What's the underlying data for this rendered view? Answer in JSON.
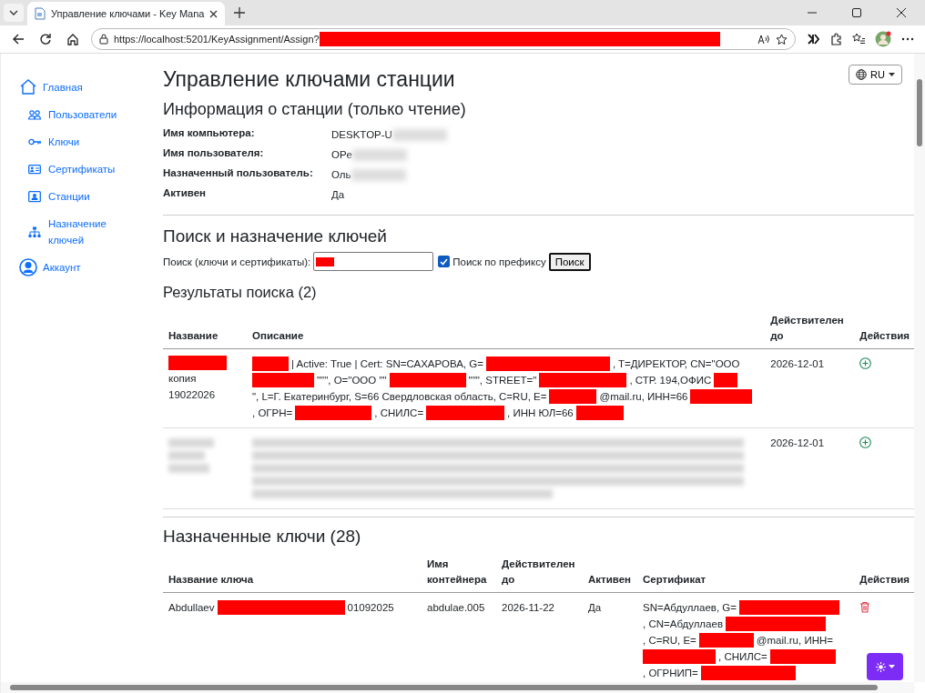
{
  "browser": {
    "tab_title": "Управление ключами - Key Mana",
    "url": "https://localhost:5201/KeyAssignment/Assign?",
    "url_redacted": true
  },
  "sidebar": {
    "items": [
      {
        "label": "Главная",
        "top": true
      },
      {
        "label": "Пользователи",
        "top": false
      },
      {
        "label": "Ключи",
        "top": false
      },
      {
        "label": "Сертификаты",
        "top": false
      },
      {
        "label": "Станции",
        "top": false
      },
      {
        "label": "Назначение ключей",
        "top": false
      },
      {
        "label": "Аккаунт",
        "top": true
      }
    ]
  },
  "language": {
    "label": "RU"
  },
  "title": "Управление ключами станции",
  "station_info": {
    "heading": "Информация о станции (только чтение)",
    "rows": [
      {
        "label": "Имя компьютера:",
        "value": "DESKTOP-U",
        "blurred": true
      },
      {
        "label": "Имя пользователя:",
        "value": "OPe",
        "blurred": true
      },
      {
        "label": "Назначенный пользователь:",
        "value": "Оль",
        "blurred": true
      },
      {
        "label": "Активен",
        "value": "Да",
        "blurred": false
      }
    ]
  },
  "search": {
    "heading": "Поиск и назначение ключей",
    "label": "Поиск (ключи и сертификаты):",
    "value_redacted": true,
    "prefix_label": "Поиск по префиксу",
    "prefix_checked": true,
    "button": "Поиск"
  },
  "results": {
    "heading": "Результаты поиска (2)",
    "columns": [
      "Название",
      "Описание",
      "Действителен до",
      "Действия"
    ],
    "rows": [
      {
        "kind": "visible",
        "name": [
          {
            "kind": "redacted"
          },
          {
            "kind": "text",
            "text": "копия 19022026"
          }
        ],
        "description": [
          {
            "kind": "redacted"
          },
          {
            "kind": "text",
            "text": "| Active: True | Cert: SN=САХАРОВА, G="
          },
          {
            "kind": "redacted"
          },
          {
            "kind": "text",
            "text": ", T=ДИРЕКТОР, CN=\"ООО"
          },
          {
            "kind": "redacted"
          },
          {
            "kind": "text",
            "text": "\"\"\", O=\"ООО \"\""
          },
          {
            "kind": "redacted"
          },
          {
            "kind": "text",
            "text": "\"\"\", STREET=\""
          },
          {
            "kind": "redacted"
          },
          {
            "kind": "text",
            "text": ", СТР. 194,ОФИС"
          },
          {
            "kind": "redacted"
          },
          {
            "kind": "text",
            "text": "\", L=Г. Екатеринбург, S=66 Свердловская область, C=RU, E="
          },
          {
            "kind": "redacted"
          },
          {
            "kind": "text",
            "text": "@mail.ru, ИНН=66"
          },
          {
            "kind": "redacted"
          },
          {
            "kind": "text",
            "text": ", ОГРН="
          },
          {
            "kind": "redacted"
          },
          {
            "kind": "text",
            "text": ", СНИЛС="
          },
          {
            "kind": "redacted"
          },
          {
            "kind": "text",
            "text": ", ИНН ЮЛ=66"
          },
          {
            "kind": "redacted"
          }
        ],
        "valid_to": "2026-12-01"
      },
      {
        "kind": "blurred",
        "valid_to": "2026-12-01"
      }
    ]
  },
  "assigned": {
    "heading": "Назначенные ключи (28)",
    "columns": [
      "Название ключа",
      "Имя контейнера",
      "Действителен до",
      "Активен",
      "Сертификат",
      "Действия"
    ],
    "rows": [
      {
        "name": [
          {
            "kind": "text",
            "text": "Abdullaev"
          },
          {
            "kind": "redacted"
          },
          {
            "kind": "text",
            "text": "01092025"
          }
        ],
        "container": "abdulae.005",
        "valid_to": "2026-11-22",
        "active": "Да",
        "certificate": [
          {
            "kind": "text",
            "text": "SN=Абдуллаев, G="
          },
          {
            "kind": "redacted"
          },
          {
            "kind": "text",
            "text": ", CN=Абдуллаев"
          },
          {
            "kind": "redacted"
          },
          {
            "kind": "text",
            "text": ", C=RU, E="
          },
          {
            "kind": "redacted"
          },
          {
            "kind": "text",
            "text": "@mail.ru, ИНН="
          },
          {
            "kind": "redacted"
          },
          {
            "kind": "text",
            "text": ", СНИЛС="
          },
          {
            "kind": "redacted"
          },
          {
            "kind": "text",
            "text": ", ОГРНИП="
          },
          {
            "kind": "redacted"
          }
        ]
      }
    ]
  }
}
